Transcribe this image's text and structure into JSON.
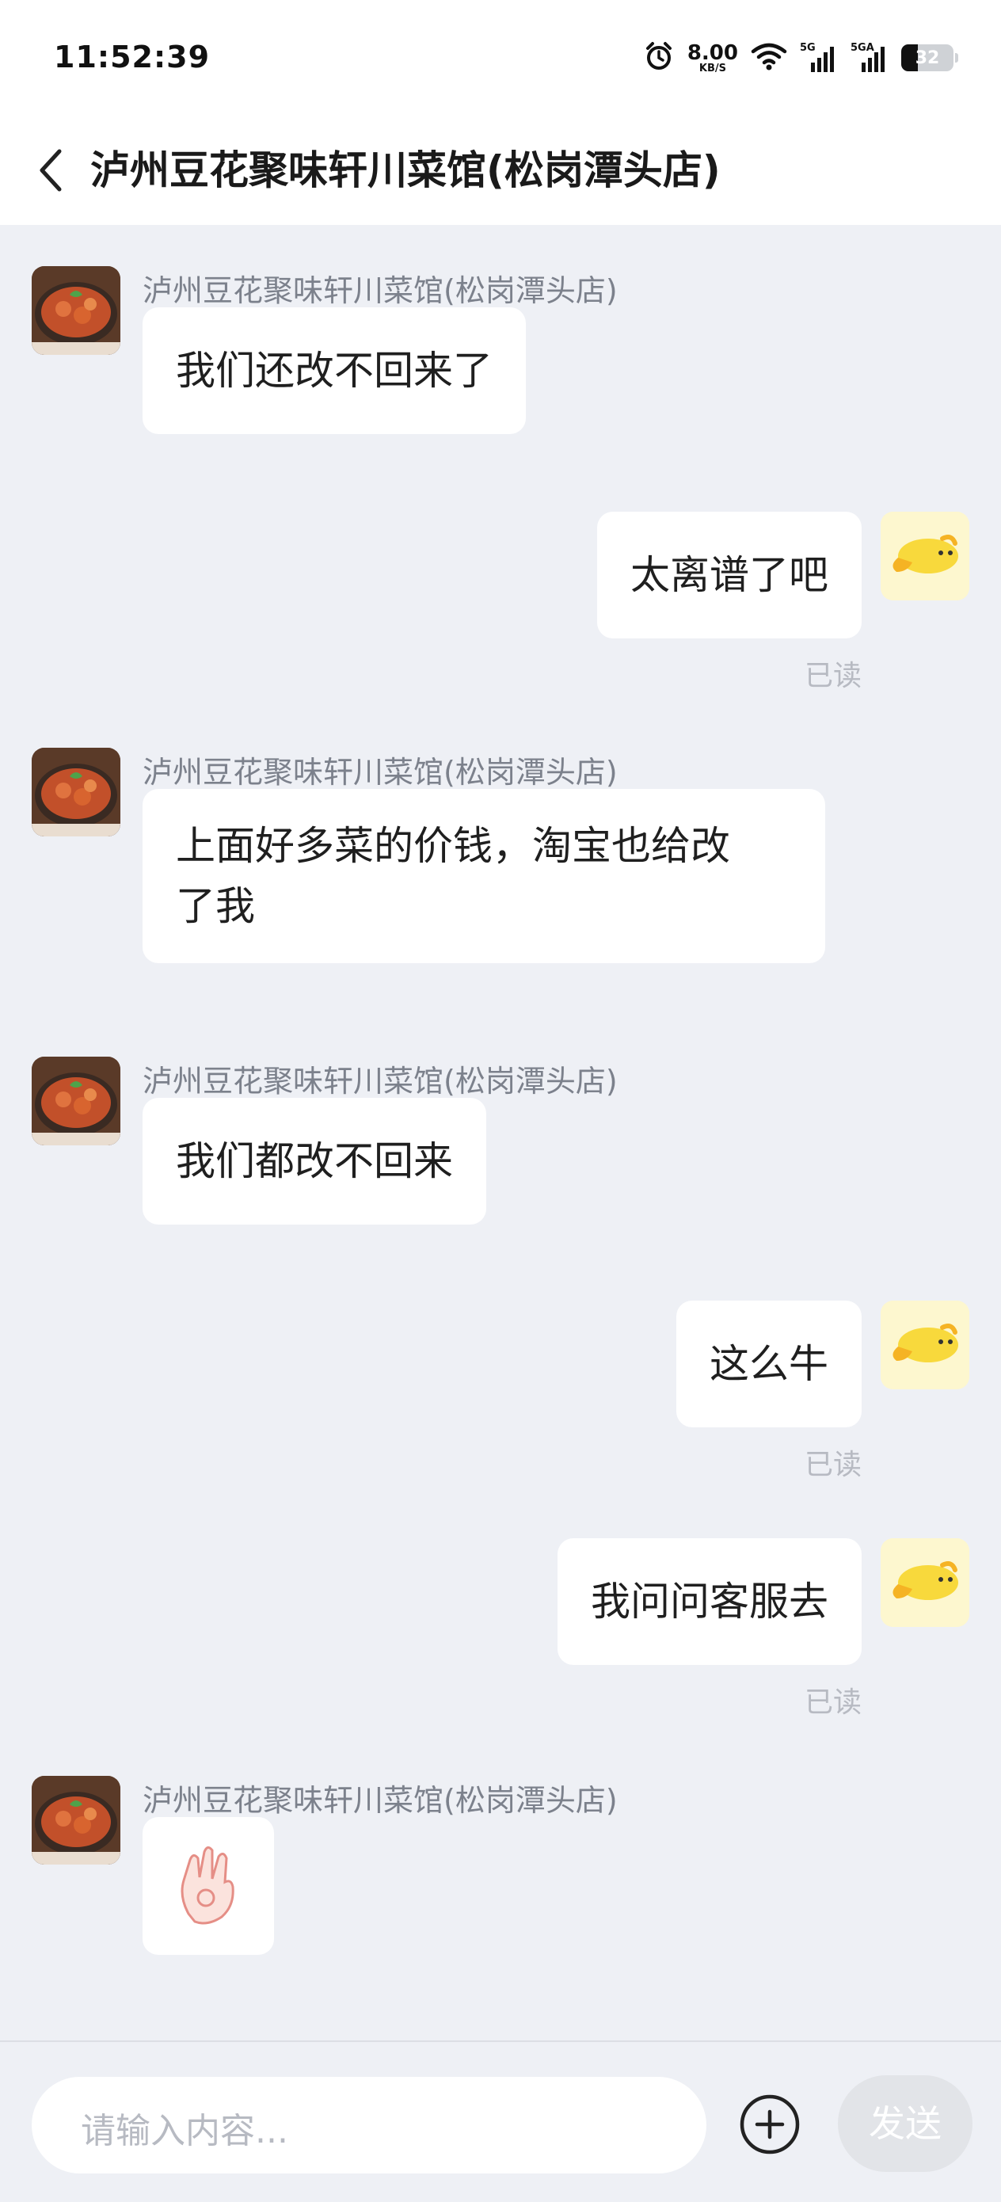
{
  "status_bar": {
    "time": "11:52:39",
    "net_speed_value": "8.00",
    "net_speed_unit": "KB/S",
    "signal1_label": "5G",
    "signal2_label": "5GA",
    "battery_level": "32"
  },
  "header": {
    "title": "泸州豆花聚味轩川菜馆(松岗潭头店)"
  },
  "messages": [
    {
      "side": "left",
      "sender": "泸州豆花聚味轩川菜馆(松岗潭头店)",
      "text": "我们还改不回来了"
    },
    {
      "side": "right",
      "text": "太离谱了吧",
      "status": "已读"
    },
    {
      "side": "left",
      "sender": "泸州豆花聚味轩川菜馆(松岗潭头店)",
      "text_line1": "上面好多菜的价钱，淘宝也给改",
      "text_line2": "了我"
    },
    {
      "side": "left",
      "sender": "泸州豆花聚味轩川菜馆(松岗潭头店)",
      "text": "我们都改不回来"
    },
    {
      "side": "right",
      "text": "这么牛",
      "status": "已读"
    },
    {
      "side": "right",
      "text": "我问问客服去",
      "status": "已读"
    },
    {
      "side": "left",
      "sender": "泸州豆花聚味轩川菜馆(松岗潭头店)",
      "emoji": "ok-hand-sticker"
    }
  ],
  "composer": {
    "placeholder": "请输入内容...",
    "send_label": "发送"
  },
  "colors": {
    "chat_background": "#eef0f5",
    "bubble": "#ffffff",
    "sender_text": "#7c818c",
    "read_text": "#b7bac2",
    "send_button": "#e2e4e8"
  },
  "icons": {
    "back": "chevron-left-icon",
    "plus": "plus-circle-icon",
    "merchant_avatar": "dish-avatar",
    "user_avatar": "yellow-bird-avatar"
  }
}
